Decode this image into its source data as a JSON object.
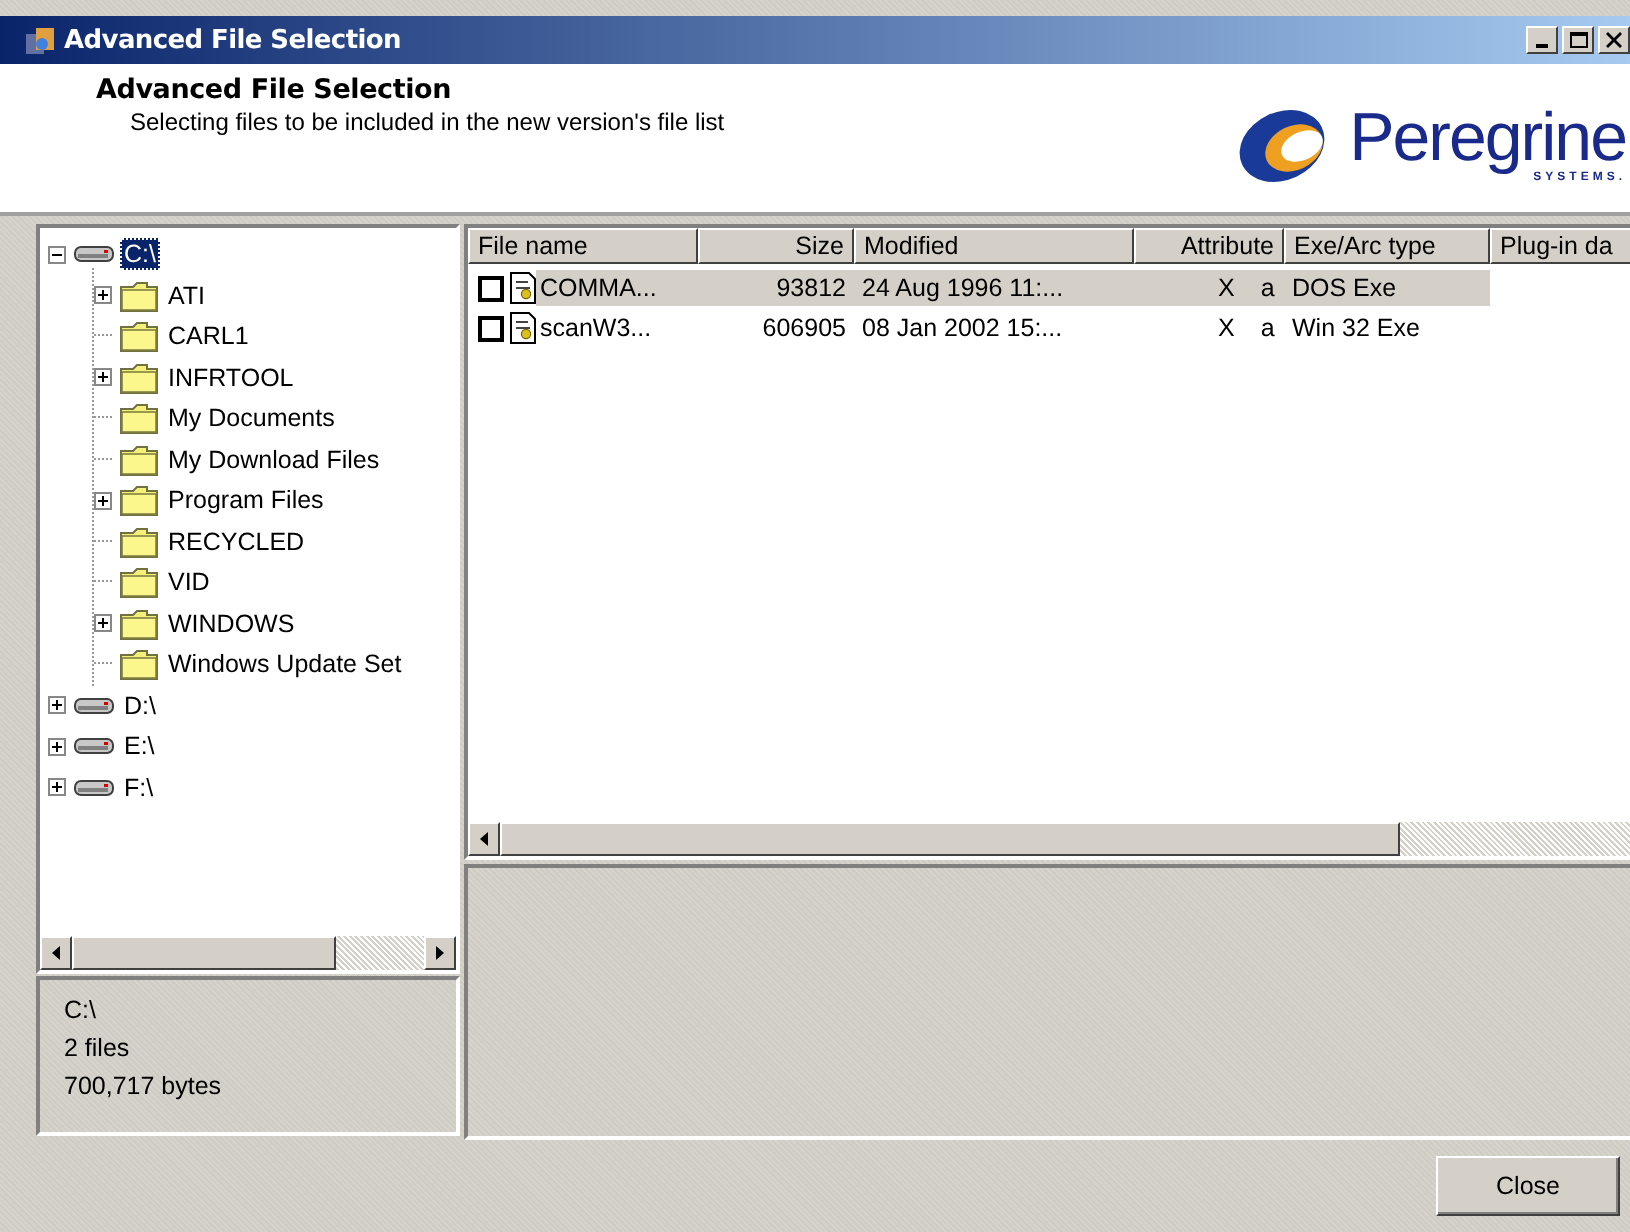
{
  "window": {
    "title": "Advanced File Selection"
  },
  "header": {
    "title": "Advanced File Selection",
    "description": "Selecting files to be included in the new version's file list"
  },
  "logo": {
    "name": "Peregrine",
    "subtitle": "SYSTEMS."
  },
  "tree": [
    {
      "label": "C:\\",
      "kind": "drive",
      "expanded": true,
      "selected": true,
      "children": [
        {
          "label": "ATI",
          "kind": "folder",
          "expanded": false,
          "selected": false
        },
        {
          "label": "CARL1",
          "kind": "folder",
          "selected": false
        },
        {
          "label": "INFRTOOL",
          "kind": "folder",
          "expanded": false,
          "selected": false
        },
        {
          "label": "My Documents",
          "kind": "folder",
          "selected": false
        },
        {
          "label": "My Download Files",
          "kind": "folder",
          "selected": false
        },
        {
          "label": "Program Files",
          "kind": "folder",
          "expanded": false,
          "selected": false
        },
        {
          "label": "RECYCLED",
          "kind": "folder",
          "selected": false
        },
        {
          "label": "VID",
          "kind": "folder",
          "selected": false
        },
        {
          "label": "WINDOWS",
          "kind": "folder",
          "expanded": false,
          "selected": false
        },
        {
          "label": "Windows Update Set",
          "kind": "folder",
          "selected": false
        }
      ]
    },
    {
      "label": "D:\\",
      "kind": "drive",
      "expanded": false,
      "selected": false
    },
    {
      "label": "E:\\",
      "kind": "drive",
      "expanded": false,
      "selected": false
    },
    {
      "label": "F:\\",
      "kind": "drive",
      "expanded": false,
      "selected": false
    }
  ],
  "summary": {
    "path": "C:\\",
    "files": "2 files",
    "bytes": "700,717 bytes"
  },
  "table": {
    "columns": [
      "File name",
      "Size",
      "Modified",
      "Attribute",
      "Exe/Arc type",
      "Plug-in da"
    ],
    "rows": [
      {
        "name": "COMMA...",
        "size": "93812",
        "modified": "24 Aug 1996 11:...",
        "attribute_flag": "X",
        "attribute": "a",
        "type": "DOS Exe",
        "checked": false,
        "selected": true
      },
      {
        "name": "scanW3...",
        "size": "606905",
        "modified": "08 Jan 2002 15:...",
        "attribute_flag": "X",
        "attribute": "a",
        "type": "Win 32 Exe",
        "checked": false,
        "selected": false
      }
    ]
  },
  "buttons": [
    "Close"
  ]
}
